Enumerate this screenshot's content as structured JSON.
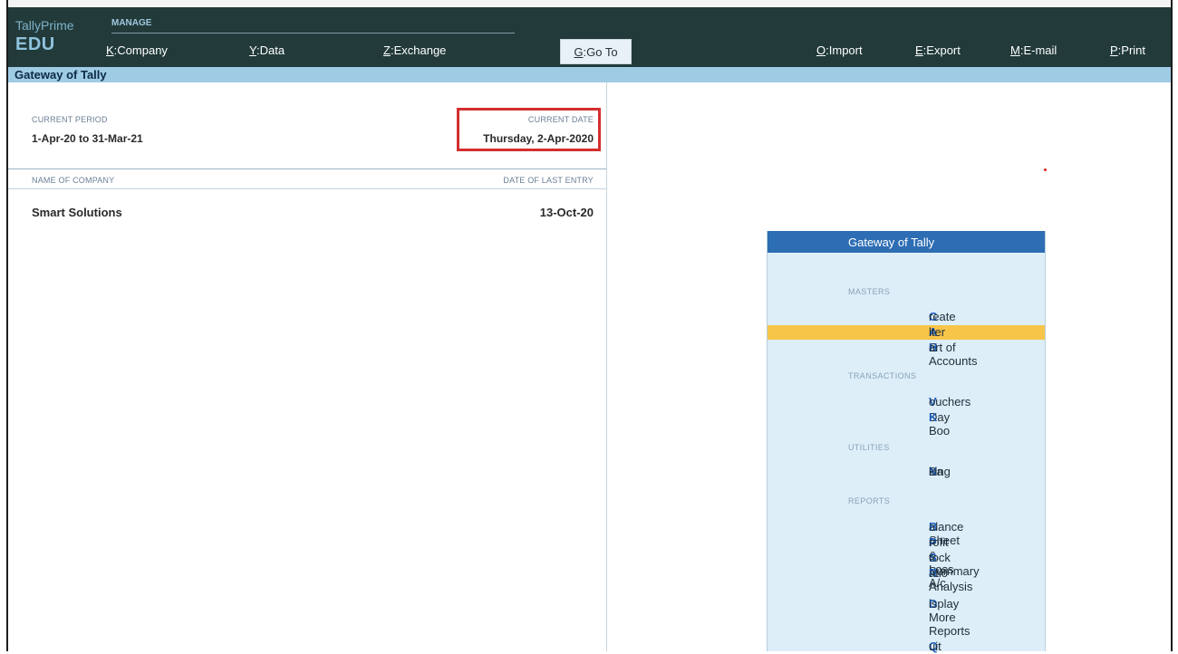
{
  "header": {
    "brand_top": "TallyPrime",
    "brand_edition": "EDU",
    "manage_label": "MANAGE",
    "menu": [
      {
        "key": "K",
        "label": "Company"
      },
      {
        "key": "Y",
        "label": "Data"
      },
      {
        "key": "Z",
        "label": "Exchange"
      },
      {
        "key": "G",
        "label": "Go To"
      },
      {
        "key": "O",
        "label": "Import"
      },
      {
        "key": "E",
        "label": "Export"
      },
      {
        "key": "M",
        "label": "E-mail"
      },
      {
        "key": "P",
        "label": "Print"
      }
    ]
  },
  "titlebar": {
    "title": "Gateway of Tally"
  },
  "company_panel": {
    "current_period_label": "CURRENT PERIOD",
    "current_period_value": "1-Apr-20 to 31-Mar-21",
    "current_date_label": "CURRENT DATE",
    "current_date_value": "Thursday, 2-Apr-2020",
    "col_name_header": "NAME OF COMPANY",
    "col_date_header": "DATE OF LAST ENTRY",
    "companies": [
      {
        "name": "Smart Solutions",
        "last_entry": "13-Oct-20"
      }
    ]
  },
  "gateway_menu": {
    "title": "Gateway of Tally",
    "sections": [
      {
        "heading": "MASTERS",
        "items": [
          {
            "hotkey": "C",
            "rest": "reate",
            "label": "Create"
          },
          {
            "hotkey": "A",
            "rest": "lter",
            "label": "Alter",
            "selected": true
          },
          {
            "pre": "C",
            "hotkey": "H",
            "rest": "art of Accounts",
            "label": "CHart of Accounts"
          }
        ]
      },
      {
        "heading": "TRANSACTIONS",
        "items": [
          {
            "hotkey": "V",
            "rest": "ouchers",
            "label": "Vouchers"
          },
          {
            "pre": "Day Boo",
            "hotkey": "K",
            "rest": "",
            "label": "Day BooK"
          }
        ]
      },
      {
        "heading": "UTILITIES",
        "items": [
          {
            "pre": "Ba",
            "hotkey": "N",
            "rest": "king",
            "label": "BaNking"
          }
        ]
      },
      {
        "heading": "REPORTS",
        "items": [
          {
            "hotkey": "B",
            "rest": "alance Sheet",
            "label": "Balance Sheet"
          },
          {
            "hotkey": "P",
            "rest": "rofit & Loss A/c",
            "label": "Profit & Loss A/c"
          },
          {
            "hotkey": "S",
            "rest": "tock Summary",
            "label": "Stock Summary"
          },
          {
            "hotkey": "R",
            "rest": "atio Analysis",
            "label": "Ratio Analysis"
          },
          {
            "hotkey": "D",
            "rest": "isplay More Reports",
            "label": "Display More Reports"
          },
          {
            "hotkey": "Q",
            "rest": "uit",
            "label": "Quit"
          }
        ]
      }
    ]
  },
  "colors": {
    "topbar": "#223a3a",
    "titlebar": "#9fcbe5",
    "menu_header": "#2d6db3",
    "menu_bg": "#ddeef9",
    "selected": "#f7c548",
    "highlight_box": "#d32f2f"
  }
}
